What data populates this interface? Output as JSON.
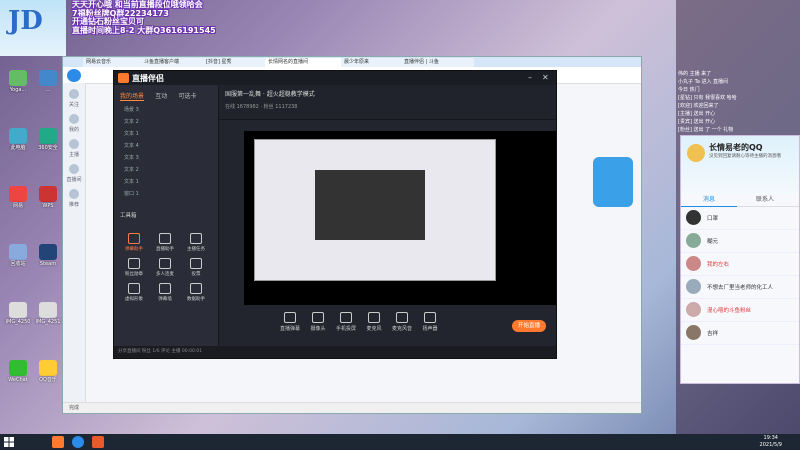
{
  "overlay": {
    "lines": [
      "天天开心哦 和当前直播段位哦领哈会",
      "7福粉丝牌Q群22234173",
      "开通钻石粉丝宝贝可",
      "直播时间晚上8-2 大群Q3616191545"
    ]
  },
  "desktop_icons": [
    {
      "label": "Yoga...",
      "color": "#6b6"
    },
    {
      "label": "...",
      "color": "#48c"
    },
    {
      "label": "此电脑",
      "color": "#4ac"
    },
    {
      "label": "360安全",
      "color": "#2a8"
    },
    {
      "label": "网易",
      "color": "#e44"
    },
    {
      "label": "WPS",
      "color": "#c33"
    },
    {
      "label": "回收站",
      "color": "#8ad"
    },
    {
      "label": "Steam",
      "color": "#247"
    },
    {
      "label": "IMG_4250",
      "color": "#ddd"
    },
    {
      "label": "IMG_4251",
      "color": "#ddd"
    },
    {
      "label": "WeChat",
      "color": "#3b3"
    },
    {
      "label": "QQ音乐",
      "color": "#fc3"
    }
  ],
  "browser": {
    "tabs": [
      "网易云音乐",
      "斗鱼直播客户端",
      "[抖音] 星秀",
      "长情网名的直播间",
      "晨少年原来",
      "直播伴侣 | 斗鱼"
    ],
    "status": "完成",
    "sidebar_items": [
      "关注",
      "我的",
      "主播",
      "直播间",
      "推荐"
    ]
  },
  "app": {
    "title": "直播伴侣",
    "left_tabs": [
      "我的场景",
      "互动",
      "可选卡"
    ],
    "scenes": [
      "场景 3",
      "文本 2",
      "文本 1",
      "文本 4",
      "文本 3",
      "文本 2",
      "文本 1",
      "窗口 1"
    ],
    "tools_title": "工具箱",
    "tools": [
      {
        "label": "弹幕助手",
        "hot": true
      },
      {
        "label": "直播助手",
        "hot": false
      },
      {
        "label": "主播任务",
        "hot": false
      },
      {
        "label": "粉丝勋章",
        "hot": false
      },
      {
        "label": "多人连麦",
        "hot": false
      },
      {
        "label": "投票",
        "hot": false
      },
      {
        "label": "虚拟形象",
        "hot": false
      },
      {
        "label": "弹幕墙",
        "hot": false
      },
      {
        "label": "数据助手",
        "hot": false
      }
    ],
    "top_title": "国服第一乱舞 · 超火超稳教学模式",
    "top_meta": "在线 1678982 · 粉丝 1117238",
    "bottom_buttons": [
      "直播弹幕",
      "摄像头",
      "手机投屏",
      "麦克风",
      "麦克风音",
      "扬声器"
    ],
    "go_live": "开始直播",
    "footer": "分享直播间  粉丝  1/6  评论  主播 00:00:01"
  },
  "chat": {
    "messages": [
      "伟的 主播 来了",
      "小丸子 Ta 进入 直播间",
      "今日 热门",
      "[星钻] 只有 我很喜欢 哈哈",
      "[欢迎] 欢迎回来了",
      "[主播] 送出 开心",
      "[贵宾] 送出 开心",
      "[粉丝] 送出 了 一个 礼物"
    ]
  },
  "qq": {
    "nickname": "长情易老的QQ",
    "signature": "没见到回复请耐心等待主播的消息哦",
    "tabs": [
      "消息",
      "联系人"
    ],
    "contacts": [
      {
        "name": "口罩",
        "red": false,
        "color": "#333"
      },
      {
        "name": "糊元",
        "red": false,
        "color": "#8a9"
      },
      {
        "name": "我的左右",
        "red": true,
        "color": "#c88"
      },
      {
        "name": "不想去厂里当老师的化工人",
        "red": false,
        "color": "#9ab"
      },
      {
        "name": "漫心嘻的斗鱼粉丝",
        "red": true,
        "color": "#caa"
      },
      {
        "name": "吉祥",
        "red": false,
        "color": "#876"
      }
    ]
  },
  "taskbar": {
    "time": "19:34",
    "date": "2021/5/9"
  }
}
